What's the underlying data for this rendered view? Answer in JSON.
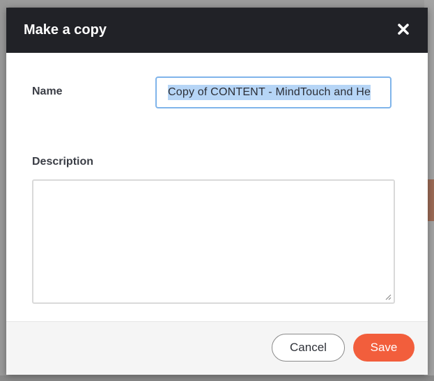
{
  "dialog": {
    "title": "Make a copy",
    "close_icon": "close-icon"
  },
  "form": {
    "name_label": "Name",
    "name_value": "Copy of CONTENT - MindTouch and He",
    "description_label": "Description",
    "description_value": ""
  },
  "footer": {
    "cancel_label": "Cancel",
    "save_label": "Save"
  },
  "colors": {
    "header_bg": "#212227",
    "save_button": "#f25e3c",
    "input_focus_border": "#7fb4ea",
    "text_selection": "#b6d5f6"
  }
}
